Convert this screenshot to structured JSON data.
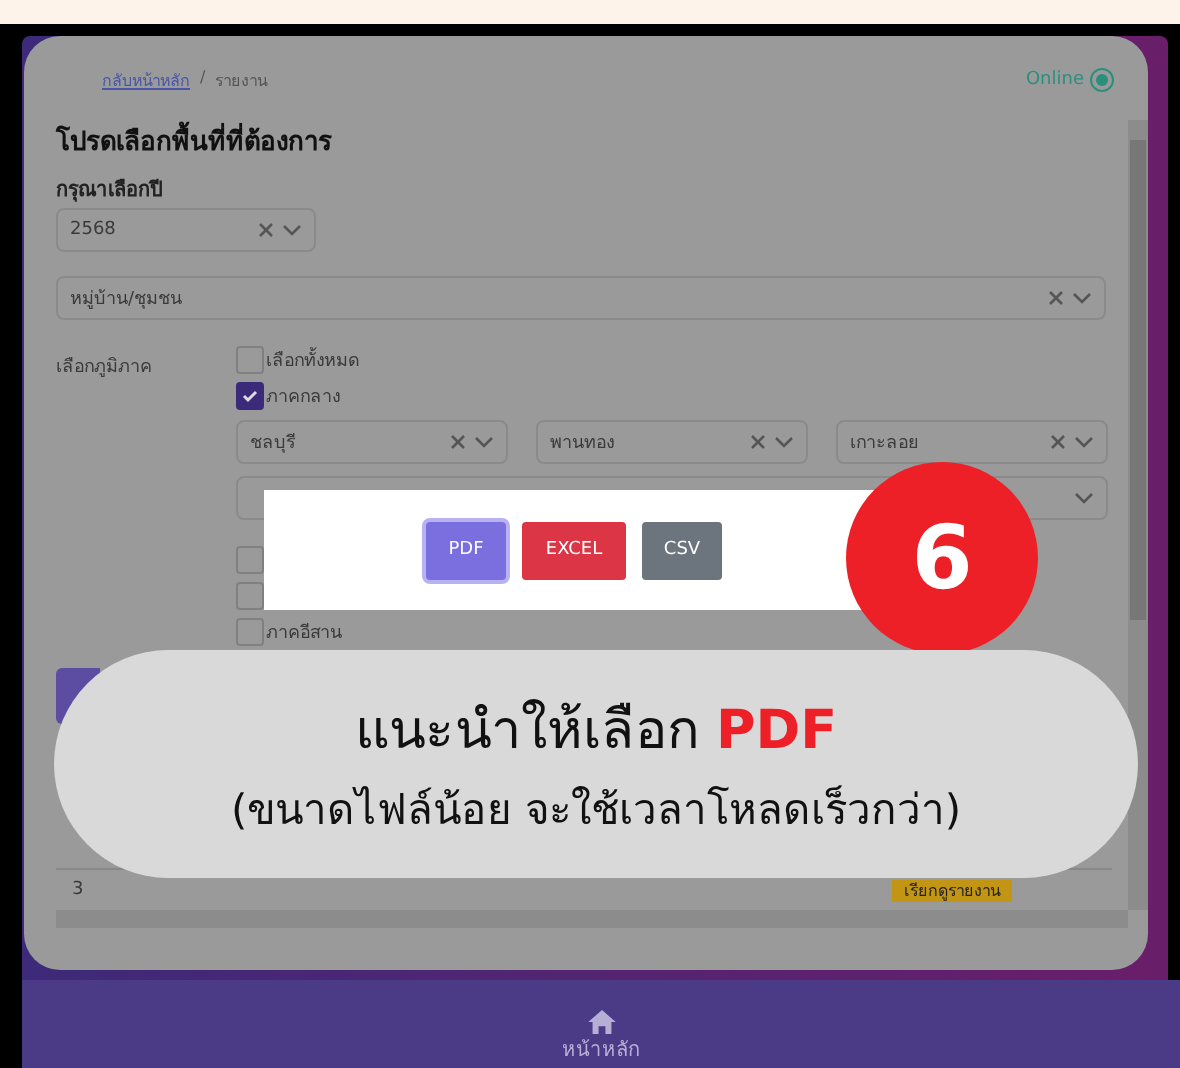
{
  "breadcrumb": {
    "link": "กลับหน้าหลัก",
    "separator": "/",
    "current": "รายงาน"
  },
  "status": {
    "label": "Online",
    "online": true
  },
  "form": {
    "title": "โปรดเลือกพื้นที่ที่ต้องการ",
    "year_label": "กรุณาเลือกปี",
    "year_select": {
      "value": "2568"
    },
    "area_select": {
      "value": "หมู่บ้าน/ชุมชน"
    },
    "region_label": "เลือกภูมิภาค",
    "regions": [
      {
        "label": "เลือกทั้งหมด",
        "checked": false
      },
      {
        "label": "ภาคกลาง",
        "checked": true
      }
    ],
    "province_selects": [
      {
        "value": "ชลบุรี"
      },
      {
        "value": "พานทอง"
      },
      {
        "value": "เกาะลอย"
      }
    ],
    "extra_regions": [
      {
        "checked": false
      },
      {
        "checked": false
      },
      {
        "label": "ภาคอีสาน",
        "checked": false
      }
    ]
  },
  "table": {
    "rows": [
      {
        "number": "3",
        "action": "เรียกดูรายงาน"
      }
    ]
  },
  "export_dialog": {
    "buttons": [
      {
        "label": "PDF",
        "kind": "pdf"
      },
      {
        "label": "EXCEL",
        "kind": "excel"
      },
      {
        "label": "CSV",
        "kind": "csv"
      }
    ]
  },
  "step_badge": "6",
  "callout": {
    "line1": "แนะนำให้เลือก",
    "highlight": "PDF",
    "line2": "(ขนาดไฟล์น้อย จะใช้เวลาโหลดเร็วกว่า)"
  },
  "bottom_nav": {
    "label": "หน้าหลัก"
  }
}
